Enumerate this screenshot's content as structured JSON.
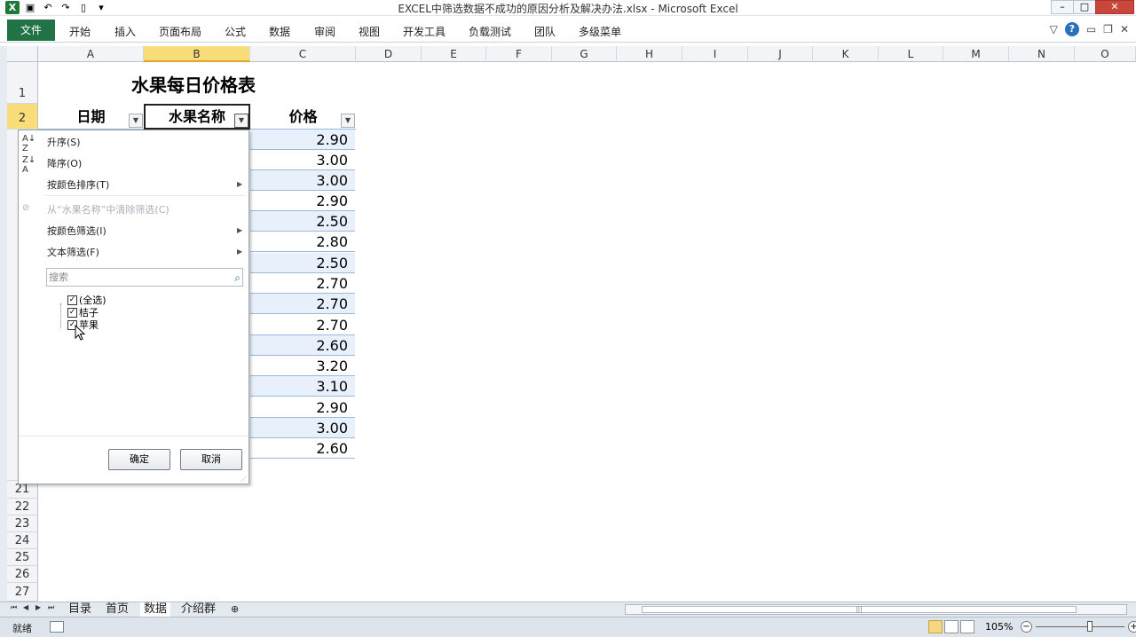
{
  "window": {
    "title": "EXCEL中筛选数据不成功的原因分析及解决办法.xlsx - Microsoft Excel",
    "minimize": "–",
    "restore": "□",
    "close": "✕"
  },
  "ribbon": {
    "file": "文件",
    "tabs": [
      "开始",
      "插入",
      "页面布局",
      "公式",
      "数据",
      "审阅",
      "视图",
      "开发工具",
      "负载测试",
      "团队",
      "多级菜单"
    ],
    "help": "?"
  },
  "columns": [
    "A",
    "B",
    "C",
    "D",
    "E",
    "F",
    "G",
    "H",
    "I",
    "J",
    "K",
    "L",
    "M",
    "N",
    "O"
  ],
  "rows_visible": {
    "top": [
      "1",
      "2"
    ],
    "bottom": [
      "21",
      "22",
      "23",
      "24",
      "25",
      "26",
      "27"
    ]
  },
  "sheet": {
    "title": "水果每日价格表",
    "headers": {
      "date": "日期",
      "fruit": "水果名称",
      "price": "价格"
    },
    "prices": [
      "2.90",
      "3.00",
      "3.00",
      "2.90",
      "2.50",
      "2.80",
      "2.50",
      "2.70",
      "2.70",
      "2.70",
      "2.60",
      "3.20",
      "3.10",
      "2.90",
      "3.00",
      "2.60"
    ]
  },
  "filter_menu": {
    "sort_asc": "升序(S)",
    "sort_desc": "降序(O)",
    "sort_by_color": "按颜色排序(T)",
    "clear_filter": "从“水果名称”中清除筛选(C)",
    "filter_by_color": "按颜色筛选(I)",
    "text_filter": "文本筛选(F)",
    "search_placeholder": "搜索",
    "items": [
      {
        "label": "(全选)",
        "checked": true
      },
      {
        "label": "桔子",
        "checked": true
      },
      {
        "label": "苹果",
        "checked": true
      }
    ],
    "ok": "确定",
    "cancel": "取消"
  },
  "sheet_tabs": [
    "目录",
    "首页",
    "数据",
    "介绍群"
  ],
  "active_sheet": "数据",
  "status": {
    "ready": "就绪",
    "zoom": "105%"
  }
}
